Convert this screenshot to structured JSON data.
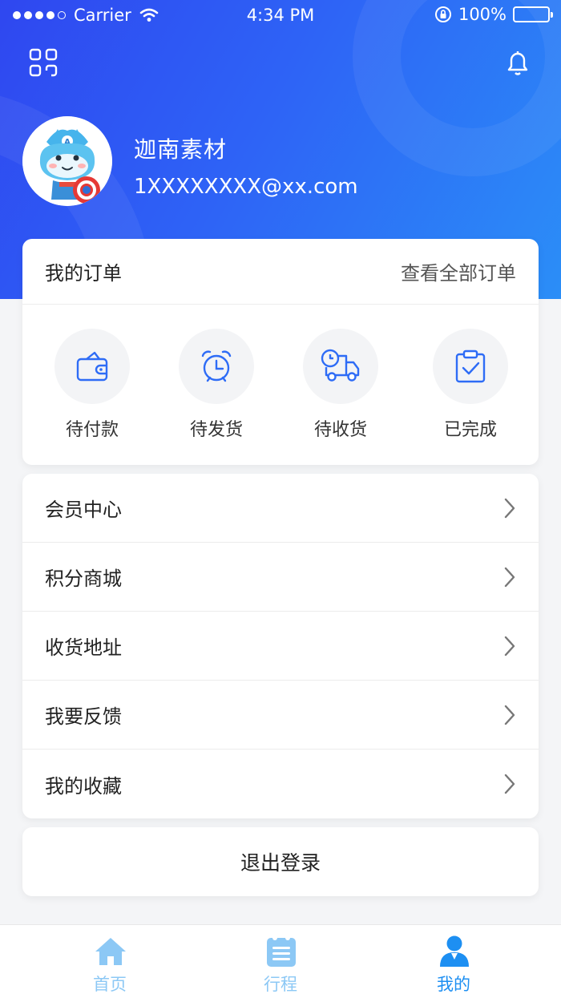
{
  "status_bar": {
    "carrier": "Carrier",
    "time": "4:34 PM",
    "battery": "100%"
  },
  "header": {
    "icons": {
      "left": "grid-icon",
      "right": "bell-icon"
    },
    "user": {
      "name": "迦南素材",
      "email": "1XXXXXXXX@xx.com"
    }
  },
  "orders": {
    "title": "我的订单",
    "view_all": "查看全部订单",
    "items": [
      {
        "label": "待付款",
        "icon": "wallet-icon"
      },
      {
        "label": "待发货",
        "icon": "alarm-clock-icon"
      },
      {
        "label": "待收货",
        "icon": "delivery-truck-icon"
      },
      {
        "label": "已完成",
        "icon": "clipboard-check-icon"
      }
    ]
  },
  "menu": {
    "items": [
      {
        "label": "会员中心"
      },
      {
        "label": "积分商城"
      },
      {
        "label": "收货地址"
      },
      {
        "label": "我要反馈"
      },
      {
        "label": "我的收藏"
      }
    ]
  },
  "logout": {
    "label": "退出登录"
  },
  "tabbar": {
    "items": [
      {
        "label": "首页",
        "icon": "home-icon"
      },
      {
        "label": "行程",
        "icon": "itinerary-icon"
      },
      {
        "label": "我的",
        "icon": "user-icon"
      }
    ]
  },
  "colors": {
    "primary": "#2e63f6",
    "tab_inactive": "#8cc8f5",
    "tab_active": "#1d8ff2",
    "icon_blue": "#2e6cf6"
  }
}
